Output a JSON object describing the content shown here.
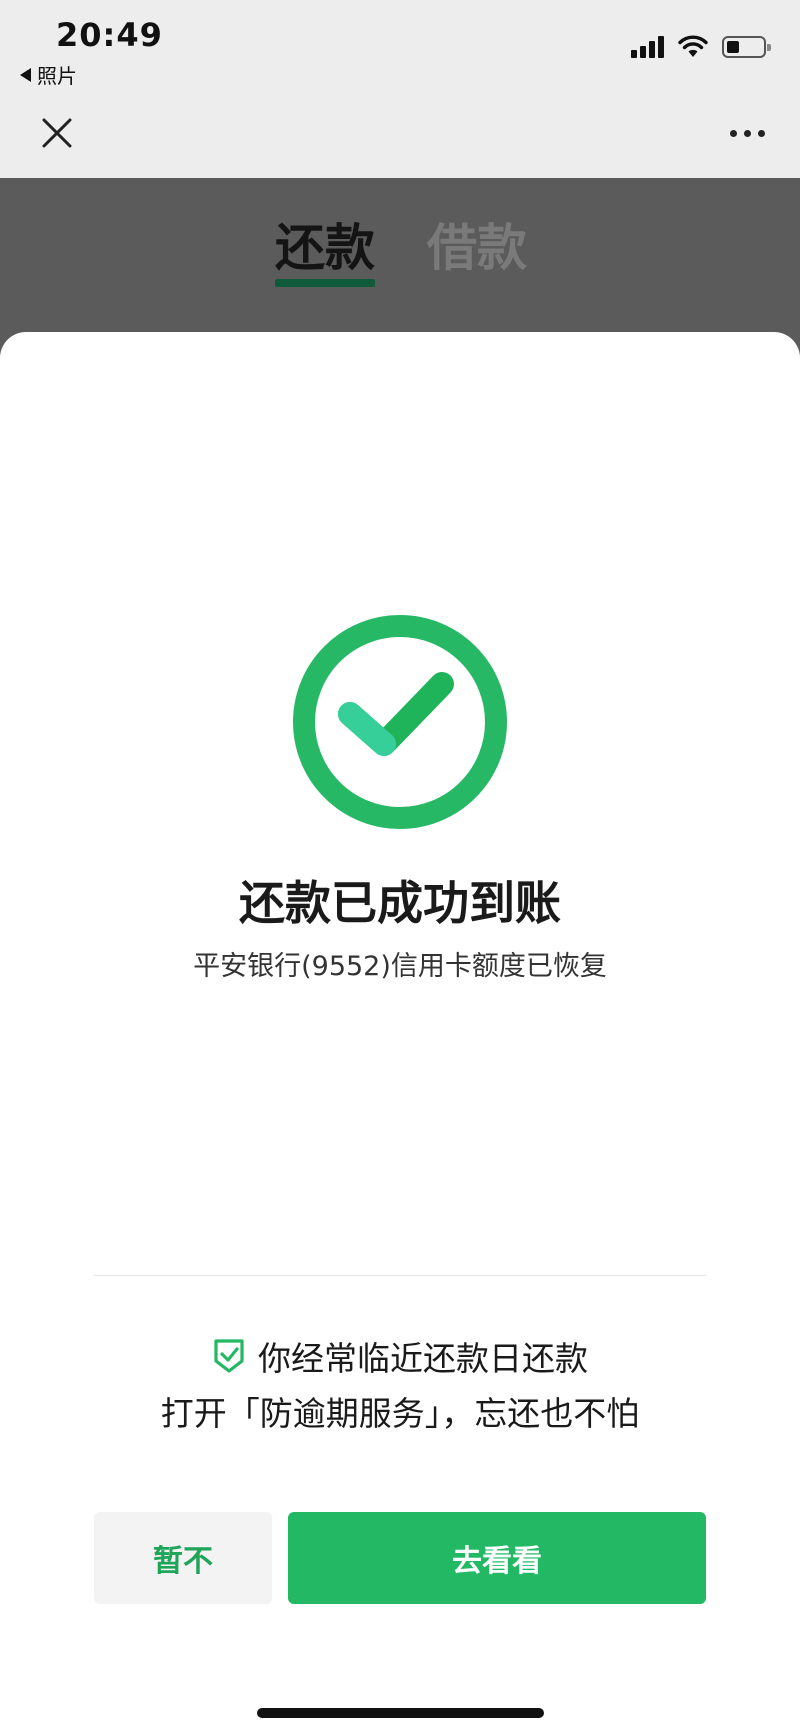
{
  "status_bar": {
    "time": "20:49",
    "back_app": "照片",
    "signal_bars": 4,
    "wifi": "wifi-icon",
    "battery_level": 0.35
  },
  "nav": {
    "close_icon": "close-icon",
    "more_icon": "more-icon"
  },
  "tabs": [
    {
      "label": "还款",
      "active": true
    },
    {
      "label": "借款",
      "active": false
    }
  ],
  "result": {
    "icon": "success-check-icon",
    "title": "还款已成功到账",
    "subtitle": "平安银行(9552)信用卡额度已恢复"
  },
  "promo": {
    "icon": "shield-check-icon",
    "line1": "你经常临近还款日还款",
    "line2": "打开「防逾期服务」，忘还也不怕"
  },
  "actions": {
    "later_label": "暂不",
    "go_label": "去看看"
  },
  "colors": {
    "accent_green": "#22b864",
    "check_ring": "#27b866",
    "check_mark": "#2cc48e",
    "tab_underline": "#0f5a3a"
  }
}
